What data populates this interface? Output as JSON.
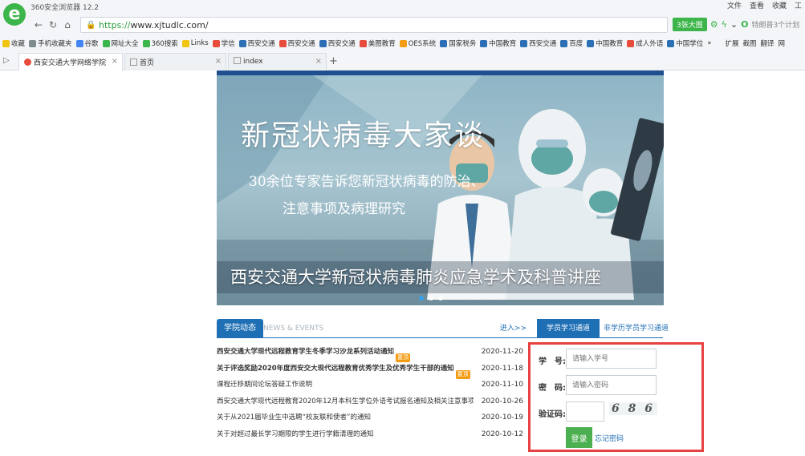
{
  "browser": {
    "app_title": "360安全浏览器 12.2",
    "logo_letter": "e",
    "top_menu": [
      "文件",
      "查看",
      "收藏",
      "工"
    ],
    "url_scheme": "https://",
    "url_rest": "www.xjtudlc.com/",
    "badge": "3张大图",
    "search_hint": "特朗普3个计划",
    "bookmarks": [
      {
        "label": "收藏",
        "color": "#f1c40f"
      },
      {
        "label": "手机收藏夹",
        "color": "#7f8c8d"
      },
      {
        "label": "谷歌",
        "color": "#4285f4"
      },
      {
        "label": "网址大全",
        "color": "#3cb54a"
      },
      {
        "label": "360搜索",
        "color": "#3cb54a"
      },
      {
        "label": "Links",
        "color": "#f1c40f"
      },
      {
        "label": "学信",
        "color": "#e74c3c"
      },
      {
        "label": "西安交通",
        "color": "#2c6fb5"
      },
      {
        "label": "西安交通",
        "color": "#e74c3c"
      },
      {
        "label": "西安交通",
        "color": "#2c6fb5"
      },
      {
        "label": "美图教育",
        "color": "#e74c3c"
      },
      {
        "label": "OES系统",
        "color": "#f39c12"
      },
      {
        "label": "国家税务",
        "color": "#2c6fb5"
      },
      {
        "label": "中国教育",
        "color": "#2c6fb5"
      },
      {
        "label": "西安交通",
        "color": "#2c6fb5"
      },
      {
        "label": "百度",
        "color": "#2c6fb5"
      },
      {
        "label": "中国教育",
        "color": "#2c6fb5"
      },
      {
        "label": "成人外语",
        "color": "#e74c3c"
      },
      {
        "label": "中国学位",
        "color": "#2c6fb5"
      }
    ],
    "bookmarks_more": "»",
    "bookmarks_right": [
      "扩展",
      "截图",
      "翻译",
      "网"
    ],
    "tabs": [
      {
        "label": "西安交通大学网络学院",
        "active": true
      },
      {
        "label": "首页",
        "active": false
      },
      {
        "label": "index",
        "active": false
      }
    ],
    "new_tab": "+"
  },
  "banner": {
    "headline": "新冠状病毒大家谈",
    "sub_line1": "30余位专家告诉您新冠状病毒的防治、",
    "sub_line2": "注意事项及病理研究",
    "caption": "西安交通大学新冠状病毒肺炎应急学术及科普讲座"
  },
  "news": {
    "tab_label": "学院动态",
    "tab_en": "NEWS & EVENTS",
    "more": "进入>>",
    "items": [
      {
        "title": "西安交通大学现代远程教育学生冬季学习沙龙系列活动通知",
        "date": "2020-11-20",
        "bold": true,
        "hot": "置顶"
      },
      {
        "title": "关于评选奖励2020年度西安交大现代远程教育优秀学生及优秀学生干部的通知",
        "date": "2020-11-18",
        "bold": true,
        "hot": "置顶"
      },
      {
        "title": "课程迁移期间论坛答疑工作说明",
        "date": "2020-11-10",
        "bold": false,
        "hot": ""
      },
      {
        "title": "西安交通大学现代远程教育2020年12月本科生学位外语考试报名通知及相关注意事项",
        "date": "2020-10-26",
        "bold": false,
        "hot": ""
      },
      {
        "title": "关于从2021届毕业生中选聘“校友联和使者”的通知",
        "date": "2020-10-19",
        "bold": false,
        "hot": ""
      },
      {
        "title": "关于对超过最长学习期限的学生进行学籍清理的通知",
        "date": "2020-10-12",
        "bold": false,
        "hot": ""
      }
    ]
  },
  "login": {
    "tab_active": "学员学习通道",
    "tab_other": "非学历学员学习通道",
    "id_label": "学　号:",
    "id_placeholder": "请输入学号",
    "pwd_label": "密　码:",
    "pwd_placeholder": "请输入密码",
    "code_label": "验证码:",
    "captcha": "6 8 6",
    "submit": "登录",
    "forgot": "忘记密码"
  },
  "colors": {
    "accent_blue": "#1f6fb5",
    "highlight_red": "#e84141",
    "login_green": "#4caf50"
  }
}
